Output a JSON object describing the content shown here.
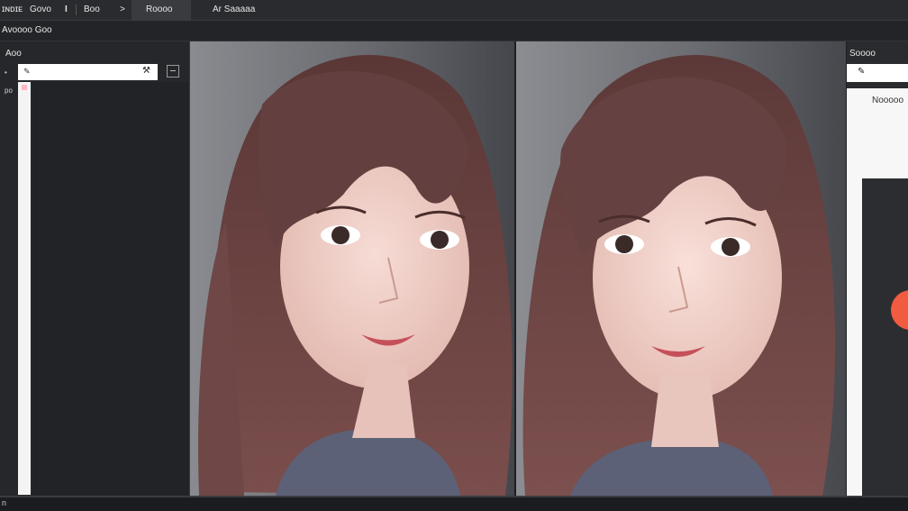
{
  "menubar": {
    "items": [
      "ɪɴᴅɪᴇ",
      "Gᴏᴠᴏ",
      "I",
      "Bᴏᴏ",
      ">",
      "Rᴏᴏᴏᴏ",
      "Ar Saaaaa"
    ]
  },
  "subbar": {
    "title": "Aᴠᴏᴏᴏᴏ Gᴏᴏ"
  },
  "left_panel": {
    "label": "Aᴏᴏ",
    "icons": [
      "•",
      "po"
    ],
    "input_icon": "pen-icon",
    "input_action_icon": "wrench-icon"
  },
  "right_panel": {
    "label": "Sᴏᴏᴏᴏ",
    "input_icon": "pen-icon",
    "heading": "Nᴏᴏᴏᴏᴏ",
    "accent_color": "#f15b3f"
  },
  "statusbar": {
    "text": "n"
  },
  "images": {
    "left": "portrait-before",
    "right": "portrait-after",
    "hair_color": "#6b4443",
    "skin_color": "#efcfc8"
  }
}
